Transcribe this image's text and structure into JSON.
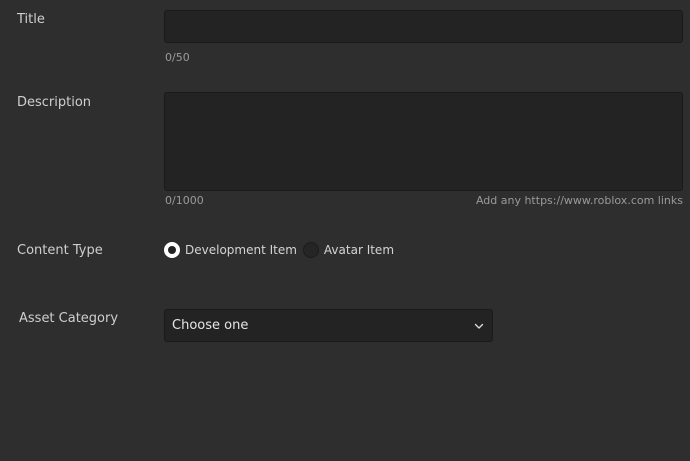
{
  "title_field": {
    "label": "Title",
    "value": "",
    "counter": "0/50"
  },
  "description_field": {
    "label": "Description",
    "value": "",
    "counter": "0/1000",
    "hint": "Add any https://www.roblox.com links"
  },
  "content_type": {
    "label": "Content Type",
    "options": [
      {
        "label": "Development Item",
        "selected": true
      },
      {
        "label": "Avatar Item",
        "selected": false
      }
    ]
  },
  "asset_category": {
    "label": "Asset Category",
    "selected": "Choose one",
    "icon": "chevron-down-icon"
  }
}
